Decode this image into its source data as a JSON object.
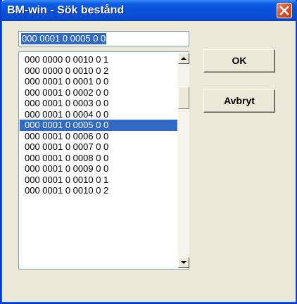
{
  "window": {
    "title": "BM-win - Sök bestånd"
  },
  "search": {
    "value": "000 0001 0 0005 0 0"
  },
  "list": {
    "items": [
      "000 0000 0 0010 0 1",
      "000 0000 0 0010 0 2",
      "000 0001 0 0001 0 0",
      "000 0001 0 0002 0 0",
      "000 0001 0 0003 0 0",
      "000 0001 0 0004 0 0",
      "000 0001 0 0005 0 0",
      "000 0001 0 0006 0 0",
      "000 0001 0 0007 0 0",
      "000 0001 0 0008 0 0",
      "000 0001 0 0009 0 0",
      "000 0001 0 0010 0 1",
      "000 0001 0 0010 0 2"
    ],
    "selected_index": 6
  },
  "buttons": {
    "ok_label": "OK",
    "cancel_label": "Avbryt"
  },
  "colors": {
    "title_bar": "#0a4cd0",
    "selection": "#316ac5",
    "dialog_bg": "#ece9d8",
    "close_button": "#d8532a"
  },
  "icons": {
    "close": "close-icon",
    "scroll_up": "arrow-up-icon",
    "scroll_down": "arrow-down-icon"
  }
}
